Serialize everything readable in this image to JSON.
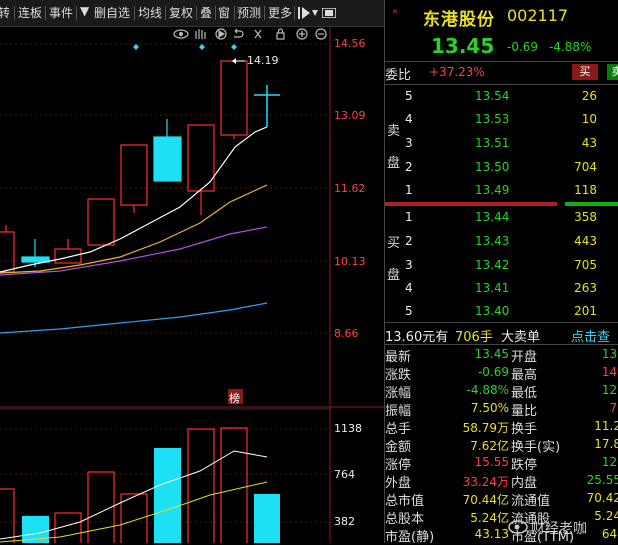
{
  "toolbar": {
    "items": [
      "转",
      "连板",
      "事件",
      "▼",
      "删自选",
      "均线",
      "复权",
      "叠",
      "窗",
      "预测",
      "更多"
    ]
  },
  "chart": {
    "price_ticks": [
      "14.56",
      "13.09",
      "11.62",
      "10.13",
      "8.66"
    ],
    "vol_ticks": [
      "1138",
      "764",
      "382"
    ],
    "high_marker": "14.19",
    "badge": "榜"
  },
  "stock": {
    "name": "东港股份",
    "code": "002117",
    "price": "13.45",
    "change": "-0.69",
    "change_pct": "-4.88%"
  },
  "weibi": {
    "label": "委比",
    "value": "+37.23%",
    "buy_btn": "买",
    "sell_btn": "卖"
  },
  "sell_side_label": "卖盘",
  "buy_side_label": "买盘",
  "asks": [
    {
      "level": "5",
      "price": "13.54",
      "vol": "26"
    },
    {
      "level": "4",
      "price": "13.53",
      "vol": "10"
    },
    {
      "level": "3",
      "price": "13.51",
      "vol": "43"
    },
    {
      "level": "2",
      "price": "13.50",
      "vol": "704"
    },
    {
      "level": "1",
      "price": "13.49",
      "vol": "118"
    }
  ],
  "bids": [
    {
      "level": "1",
      "price": "13.44",
      "vol": "358"
    },
    {
      "level": "2",
      "price": "13.43",
      "vol": "443"
    },
    {
      "level": "3",
      "price": "13.42",
      "vol": "705"
    },
    {
      "level": "4",
      "price": "13.41",
      "vol": "263"
    },
    {
      "level": "5",
      "price": "13.40",
      "vol": "201"
    }
  ],
  "bigorder": {
    "text1": "13.60元有",
    "text2": "706手",
    "text3": "大卖单",
    "link": "点击查"
  },
  "stats": [
    {
      "l1": "最新",
      "v1": "13.45",
      "c1": "green",
      "l2": "开盘",
      "v2": "13.",
      "c2": "green"
    },
    {
      "l1": "涨跌",
      "v1": "-0.69",
      "c1": "green",
      "l2": "最高",
      "v2": "14.",
      "c2": "red"
    },
    {
      "l1": "涨幅",
      "v1": "-4.88%",
      "c1": "green",
      "l2": "最低",
      "v2": "12.",
      "c2": "green"
    },
    {
      "l1": "振幅",
      "v1": "7.50%",
      "c1": "yellow",
      "l2": "量比",
      "v2": "7.",
      "c2": "red"
    },
    {
      "l1": "总手",
      "v1": "58.79万",
      "c1": "yellow",
      "l2": "换手",
      "v2": "11.2",
      "c2": "yellow"
    },
    {
      "l1": "金额",
      "v1": "7.62亿",
      "c1": "yellow",
      "l2": "换手(实)",
      "v2": "17.8",
      "c2": "yellow"
    },
    {
      "l1": "涨停",
      "v1": "15.55",
      "c1": "red",
      "l2": "跌停",
      "v2": "12.",
      "c2": "green"
    },
    {
      "l1": "外盘",
      "v1": "33.24万",
      "c1": "red",
      "l2": "内盘",
      "v2": "25.55",
      "c2": "green"
    },
    {
      "l1": "总市值",
      "v1": "70.44亿",
      "c1": "yellow",
      "l2": "流通值",
      "v2": "70.42",
      "c2": "yellow"
    },
    {
      "l1": "总股本",
      "v1": "5.24亿",
      "c1": "yellow",
      "l2": "流通股",
      "v2": "5.24",
      "c2": "yellow"
    },
    {
      "l1": "市盈(静)",
      "v1": "43.13",
      "c1": "yellow",
      "l2": "市盈(TTM)",
      "v2": "64.",
      "c2": "yellow"
    }
  ],
  "watermark": "财经老咖",
  "colors": {
    "up": "#ff3030",
    "down": "#1ee0f5",
    "ma5": "#ffffff",
    "ma10": "#e8b830",
    "ma20": "#b050e0",
    "ma60": "#30a0f0"
  }
}
